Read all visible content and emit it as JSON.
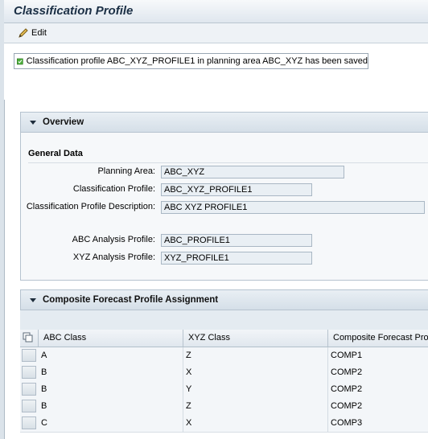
{
  "header": {
    "title": "Classification Profile"
  },
  "toolbar": {
    "edit_label": "Edit",
    "edit_icon": "pencil-icon"
  },
  "message": {
    "icon": "success-check-icon",
    "text": "Classification profile ABC_XYZ_PROFILE1 in planning area ABC_XYZ has been saved"
  },
  "overview": {
    "title": "Overview",
    "section_title": "General Data",
    "fields": {
      "planning_area": {
        "label": "Planning Area:",
        "value": "ABC_XYZ"
      },
      "classification_profile": {
        "label": "Classification Profile:",
        "value": "ABC_XYZ_PROFILE1"
      },
      "classification_profile_description": {
        "label": "Classification Profile Description:",
        "value": "ABC XYZ PROFILE1"
      },
      "abc_analysis_profile": {
        "label": "ABC Analysis Profile:",
        "value": "ABC_PROFILE1"
      },
      "xyz_analysis_profile": {
        "label": "XYZ Analysis Profile:",
        "value": "XYZ_PROFILE1"
      }
    }
  },
  "assignment": {
    "title": "Composite Forecast Profile Assignment",
    "columns": [
      "ABC Class",
      "XYZ Class",
      "Composite Forecast Profi"
    ],
    "rows": [
      [
        "A",
        "Z",
        "COMP1"
      ],
      [
        "B",
        "X",
        "COMP2"
      ],
      [
        "B",
        "Y",
        "COMP2"
      ],
      [
        "B",
        "Z",
        "COMP2"
      ],
      [
        "C",
        "X",
        "COMP3"
      ]
    ]
  },
  "colors": {
    "title_text": "#1b2f45",
    "panel_header": "#d5dfe8",
    "input_readonly": "#e9eff4",
    "success_green": "#3a8f2c"
  }
}
